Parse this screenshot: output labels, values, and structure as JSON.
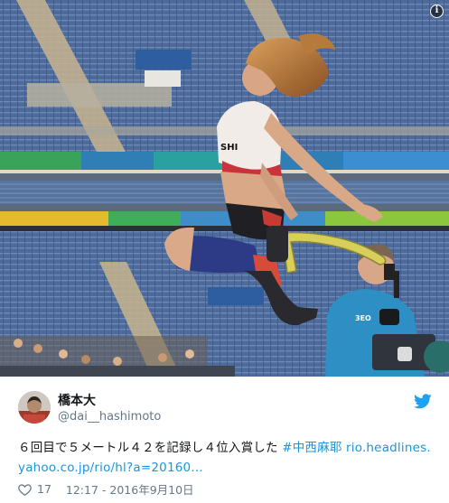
{
  "tweet": {
    "display_name": "橋本大",
    "handle": "@dai__hashimoto",
    "text": "６回目で５メートル４２を記録し４位入賞した",
    "hashtag": "#中西麻耶",
    "link": "rio.headlines.yahoo.co.jp/rio/hl?a=20160…",
    "like_count": "17",
    "timestamp": "12:17 - 2016年9月10日"
  },
  "photo": {
    "bib_text": "SHI",
    "camera_text": "3EO",
    "info_glyph": "i"
  },
  "icons": {
    "info": "info-icon",
    "bird": "twitter-bird-icon",
    "heart": "heart-icon"
  },
  "colors": {
    "link": "#1b95e0",
    "secondary_text": "#657786",
    "twitter_blue": "#1da1f2"
  }
}
